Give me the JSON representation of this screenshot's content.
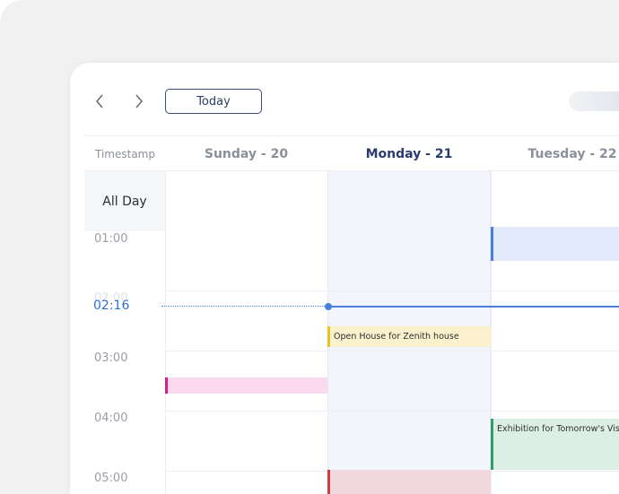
{
  "toolbar": {
    "today_label": "Today"
  },
  "header": {
    "timestamp_label": "Timestamp",
    "days": [
      {
        "label": "Sunday - 20",
        "active": false
      },
      {
        "label": "Monday - 21",
        "active": true
      },
      {
        "label": "Tuesday - 22",
        "active": false
      }
    ]
  },
  "allday_label": "All Day",
  "times": [
    "01:00",
    "02:00",
    "03:00",
    "04:00",
    "05:00"
  ],
  "now_label": "02:16",
  "events": [
    {
      "id": "tuesday-0100",
      "title": "",
      "color": "#4a7fe0",
      "bg": "#e1e9fb"
    },
    {
      "id": "monday-open-house",
      "title": "Open House for Zenith house",
      "color": "#e8c21f",
      "bg": "#fbf1cc"
    },
    {
      "id": "sunday-pink",
      "title": "",
      "color": "#d61f8a",
      "bg": "#fbd9ee"
    },
    {
      "id": "tuesday-exhibition",
      "title": "Exhibition for Tomorrow's Vision",
      "color": "#2f9e6a",
      "bg": "#dcefe4"
    },
    {
      "id": "monday-red",
      "title": "",
      "color": "#d63848",
      "bg": "#f2d8dc"
    }
  ],
  "colors": {
    "accent": "#2b3b6b",
    "now_line": "#4a7fe0"
  }
}
